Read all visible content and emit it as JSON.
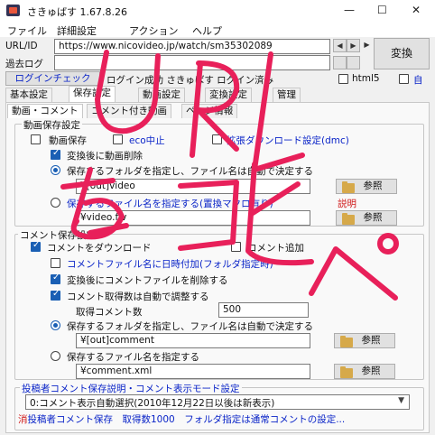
{
  "window": {
    "title": "さきゅばす 1.67.8.26",
    "minimize": "—",
    "maximize": "☐",
    "close": "✕"
  },
  "menu": [
    "ファイル",
    "詳細設定",
    "アクション",
    "ヘルプ"
  ],
  "url_row": {
    "label": "URL/ID",
    "value": "https://www.nicovideo.jp/watch/sm35302089",
    "nav_buttons": [
      "◀",
      "▶",
      "■",
      "▶"
    ],
    "convert_label": "変換"
  },
  "log_row": {
    "label": "過去ログ",
    "value": "",
    "buttons": [
      "■",
      "■"
    ]
  },
  "login_row": {
    "login_check": "ログインチェック",
    "status": "ログイン成功 さきゅばす ログイン済み",
    "html5": "html5",
    "right_label": "自"
  },
  "tabs": [
    "基本設定",
    "保存設定",
    "動画設定",
    "変換設定",
    "管理"
  ],
  "subtabs": [
    "動画・コメント",
    "コメント付き動画",
    "ページ情報"
  ],
  "video_group": {
    "title": "動画保存設定",
    "save_video": "動画保存",
    "eco_label": "eco中止",
    "dmc_label": "拡張ダウンロード設定(dmc)",
    "delete_after": "変換後に動画削除",
    "radio_folder": "保存するフォルダを指定し、ファイル名は自動で決定する",
    "folder_path": "¥[out]video",
    "browse": "参照",
    "radio_file": "保存するファイル名を指定する(置換マクロ有り)",
    "explain": "説明",
    "file_path": "¥video.flv",
    "browse2": "参照"
  },
  "comment_group": {
    "title": "コメント保存設定",
    "download": "コメントをダウンロード",
    "append": "コメント追加",
    "date_suffix": "コメントファイル名に日時付加(フォルダ指定時)",
    "delete_after": "変換後にコメントファイルを削除する",
    "auto_adjust": "コメント取得数は自動で調整する",
    "count_label": "取得コメント数",
    "count_value": "500",
    "radio_folder": "保存するフォルダを指定し、ファイル名は自動で決定する",
    "folder_path": "¥[out]comment",
    "browse": "参照",
    "radio_file": "保存するファイル名を指定する",
    "file_path": "¥comment.xml",
    "browse2": "参照"
  },
  "poster_group": {
    "title": "投稿者コメント保存説明・コメント表示モード設定",
    "mode_select": "0:コメント表示自動選択(2010年12月22日以後は新表示)",
    "bottom_red": "消",
    "bottom_text": "投稿者コメント保存　取得数1000　フォルダ指定は通常コメントの設定..."
  },
  "handwriting": {
    "color": "#e8205a",
    "text": "URLをコピペ"
  }
}
